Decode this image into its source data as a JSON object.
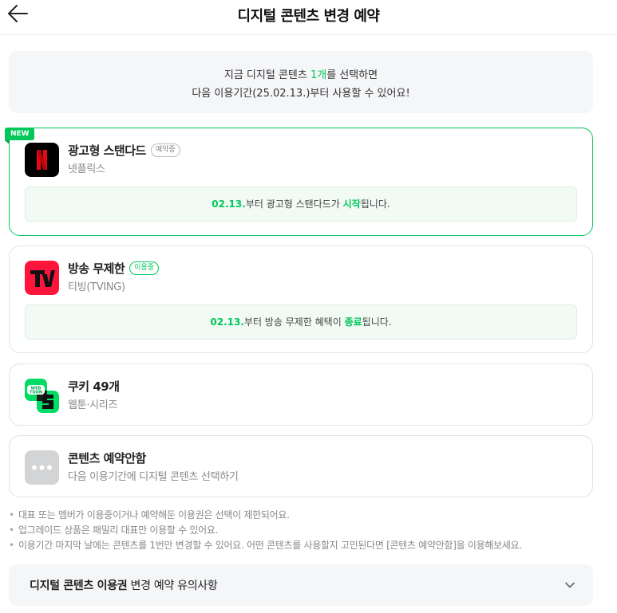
{
  "header": {
    "title": "디지털 콘텐츠 변경 예약",
    "back_icon": "arrow-left-icon"
  },
  "notice": {
    "line1_before": "지금 디지털 콘텐츠 ",
    "line1_highlight": "1개",
    "line1_after": "를 선택하면",
    "line2": "다음 이용기간(25.02.13.)부터 사용할 수 있어요!"
  },
  "cards": [
    {
      "badge": "NEW",
      "logo": "netflix-logo",
      "title": "광고형 스탠다드",
      "status": "예약중",
      "subtitle": "넷플릭스",
      "info_date": "02.13.",
      "info_mid": "부터 광고형 스탠다드가 ",
      "info_highlight": "시작",
      "info_end": "됩니다."
    },
    {
      "logo": "tving-logo",
      "title": "방송 무제한",
      "status": "이용중",
      "subtitle": "티빙(TVING)",
      "info_date": "02.13.",
      "info_mid": "부터 방송 무제한 혜택이 ",
      "info_highlight": "종료",
      "info_end": "됩니다."
    },
    {
      "logo": "webtoon-series-logo",
      "logo_text": "WEB TOON",
      "title": "쿠키 49개",
      "subtitle": "웹툰·시리즈"
    },
    {
      "logo": "more-dots-icon",
      "title": "콘텐츠 예약안함",
      "subtitle": "다음 이용기간에 디지털 콘텐츠 선택하기"
    }
  ],
  "bullets": [
    "대표 또는 멤버가 이용중이거나 예약해둔 이용권은 선택이 제한되어요.",
    "업그레이드 상품은 패밀리 대표만 이용할 수 있어요.",
    "이용기간 마지막 날에는 콘텐츠를 1번만 변경할 수 있어요. 어떤 콘텐츠를 사용할지 고민된다면 [콘텐츠 예약안함]을 이용해보세요."
  ],
  "accordion": {
    "title_bold": "디지털 콘텐츠 이용권",
    "title_rest": " 변경 예약 유의사항",
    "icon": "chevron-down-icon"
  },
  "colors": {
    "accent": "#03c75a",
    "netflix_red": "#e50914",
    "tving_red": "#ff153c",
    "webtoon_green": "#00dc64"
  }
}
